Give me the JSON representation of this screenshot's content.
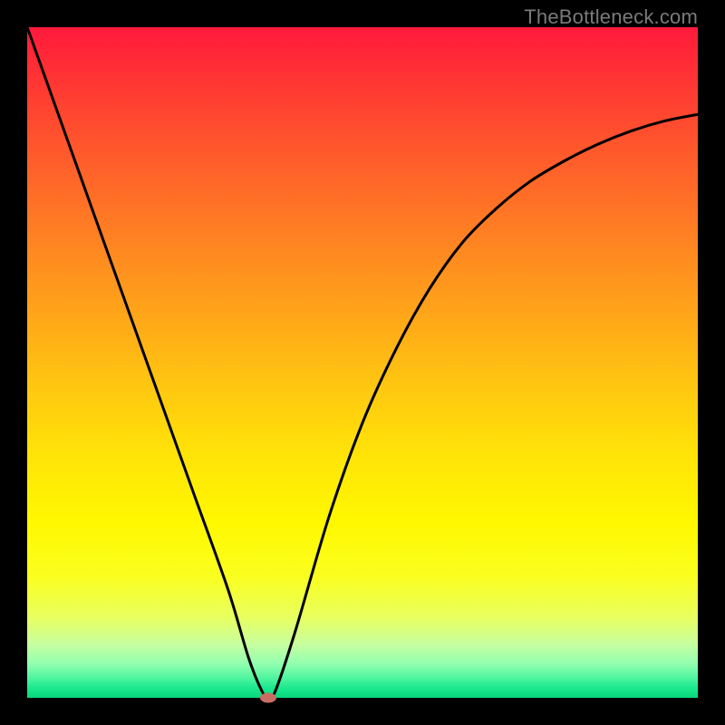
{
  "watermark": "TheBottleneck.com",
  "colors": {
    "frame": "#000000",
    "curve_stroke": "#000000",
    "marker_fill": "#c86d64",
    "watermark_text": "#7a7a7a"
  },
  "chart_data": {
    "type": "line",
    "title": "",
    "xlabel": "",
    "ylabel": "",
    "xlim": [
      0,
      100
    ],
    "ylim": [
      0,
      100
    ],
    "grid": false,
    "series": [
      {
        "name": "bottleneck-curve",
        "x": [
          0,
          5,
          10,
          15,
          20,
          25,
          30,
          33,
          35,
          36,
          37,
          40,
          45,
          50,
          55,
          60,
          65,
          70,
          75,
          80,
          85,
          90,
          95,
          100
        ],
        "values": [
          100,
          86,
          72,
          58,
          44,
          30,
          16,
          6,
          1,
          0,
          1,
          10,
          27,
          41,
          52,
          61,
          68,
          73,
          77,
          80,
          82.5,
          84.5,
          86,
          87
        ]
      }
    ],
    "annotations": [
      {
        "name": "minimum-marker",
        "x": 36,
        "y": 0
      }
    ],
    "background_gradient": {
      "orientation": "vertical",
      "stops": [
        {
          "pos": 0.0,
          "color": "#ff1a3c"
        },
        {
          "pos": 0.5,
          "color": "#ffc810"
        },
        {
          "pos": 0.8,
          "color": "#fff800"
        },
        {
          "pos": 1.0,
          "color": "#06d97c"
        }
      ]
    }
  }
}
